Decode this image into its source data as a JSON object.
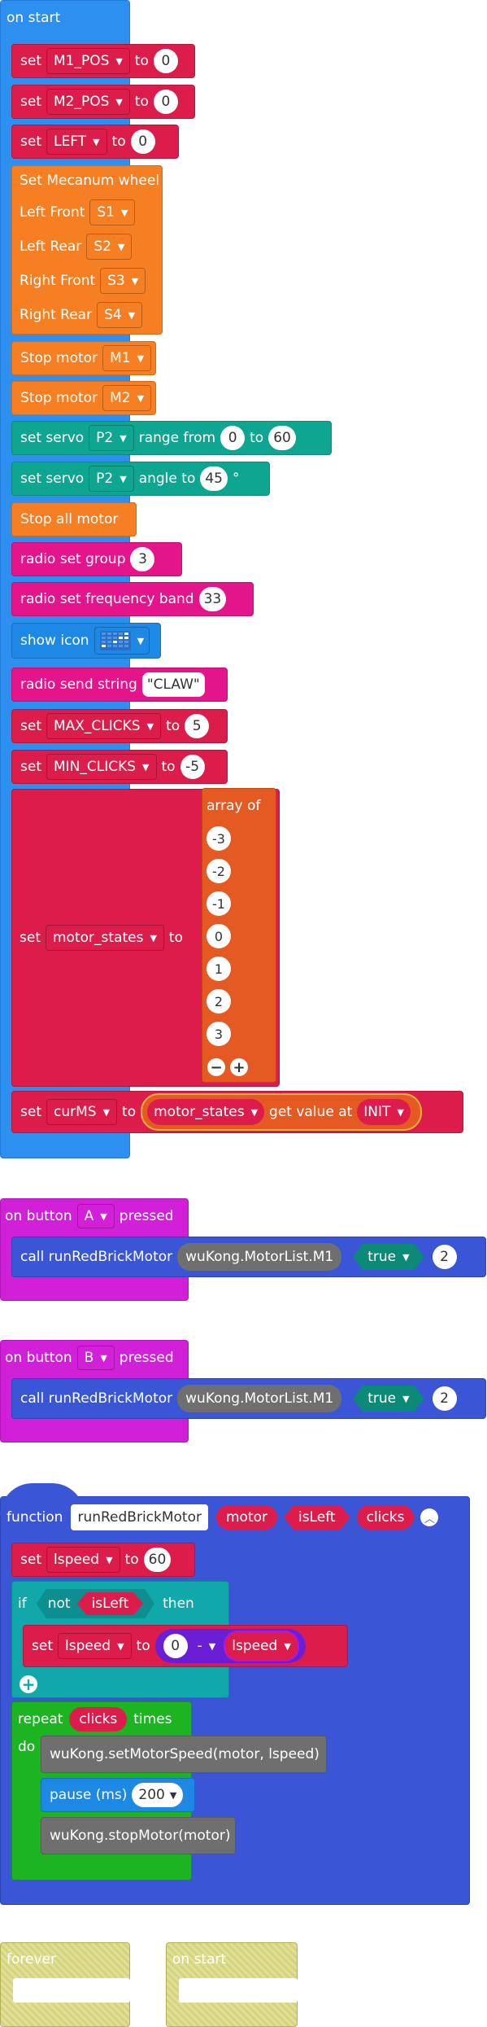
{
  "on_start": {
    "hat": "on start",
    "set": "set",
    "to": "to",
    "m1_var": "M1_POS",
    "m1_val": "0",
    "m2_var": "M2_POS",
    "m2_val": "0",
    "left_var": "LEFT",
    "left_val": "0",
    "mecanum_title": "Set Mecanum wheel",
    "lf_label": "Left Front",
    "lf_val": "S1",
    "lr_label": "Left Rear",
    "lr_val": "S2",
    "rf_label": "Right Front",
    "rf_val": "S3",
    "rr_label": "Right Rear",
    "rr_val": "S4",
    "stop_motor": "Stop motor",
    "stop_m1": "M1",
    "stop_m2": "M2",
    "set_servo": "set servo",
    "servo_p1": "P2",
    "range_from": "range from",
    "range_min": "0",
    "range_max": "60",
    "servo_p2": "P2",
    "angle_to": "angle to",
    "angle_val": "45",
    "degree": "°",
    "stop_all": "Stop all motor",
    "radio_group": "radio set group",
    "radio_group_val": "3",
    "radio_freq": "radio set frequency band",
    "radio_freq_val": "33",
    "show_icon": "show icon",
    "radio_send": "radio send string",
    "radio_send_val": "\"CLAW\"",
    "max_var": "MAX_CLICKS",
    "max_val": "5",
    "min_var": "MIN_CLICKS",
    "min_val": "-5",
    "states_var": "motor_states",
    "array_of": "array of",
    "array_items": [
      "-3",
      "-2",
      "-1",
      "0",
      "1",
      "2",
      "3"
    ],
    "curms_var": "curMS",
    "get_value_at": "get value at",
    "index_var": "INIT"
  },
  "button_a": {
    "hat_pre": "on button",
    "button": "A",
    "hat_post": "pressed",
    "call": "call runRedBrickMotor",
    "motor": "wuKong.MotorList.M1",
    "bool": "true",
    "clicks": "2"
  },
  "button_b": {
    "hat_pre": "on button",
    "button": "B",
    "hat_post": "pressed",
    "call": "call runRedBrickMotor",
    "motor": "wuKong.MotorList.M1",
    "bool": "true",
    "clicks": "2"
  },
  "function": {
    "keyword": "function",
    "name": "runRedBrickMotor",
    "param1": "motor",
    "param2": "isLeft",
    "param3": "clicks",
    "set": "set",
    "lspeed_var": "lspeed",
    "to": "to",
    "lspeed_val": "60",
    "if": "if",
    "not": "not",
    "is_left": "isLeft",
    "then": "then",
    "zero": "0",
    "minus": "-",
    "lspeed_ref": "lspeed",
    "repeat": "repeat",
    "clicks_ref": "clicks",
    "times": "times",
    "do": "do",
    "set_speed": "wuKong.setMotorSpeed(motor, lspeed)",
    "pause": "pause (ms)",
    "pause_val": "200",
    "stop_motor": "wuKong.stopMotor(motor)"
  },
  "forever": {
    "label": "forever"
  },
  "on_start_empty": {
    "label": "on start"
  },
  "colors": {
    "variables": "#dc1d4b",
    "wukong": "#f57f22",
    "servo": "#0fa691",
    "radio": "#e4148b",
    "basic": "#2d8ff0",
    "arrays": "#e55a22",
    "input": "#d21fd8",
    "functions": "#3a55d6",
    "loops": "#1cb521",
    "logic": "#11a8ab",
    "code": "#6f6f6f"
  }
}
